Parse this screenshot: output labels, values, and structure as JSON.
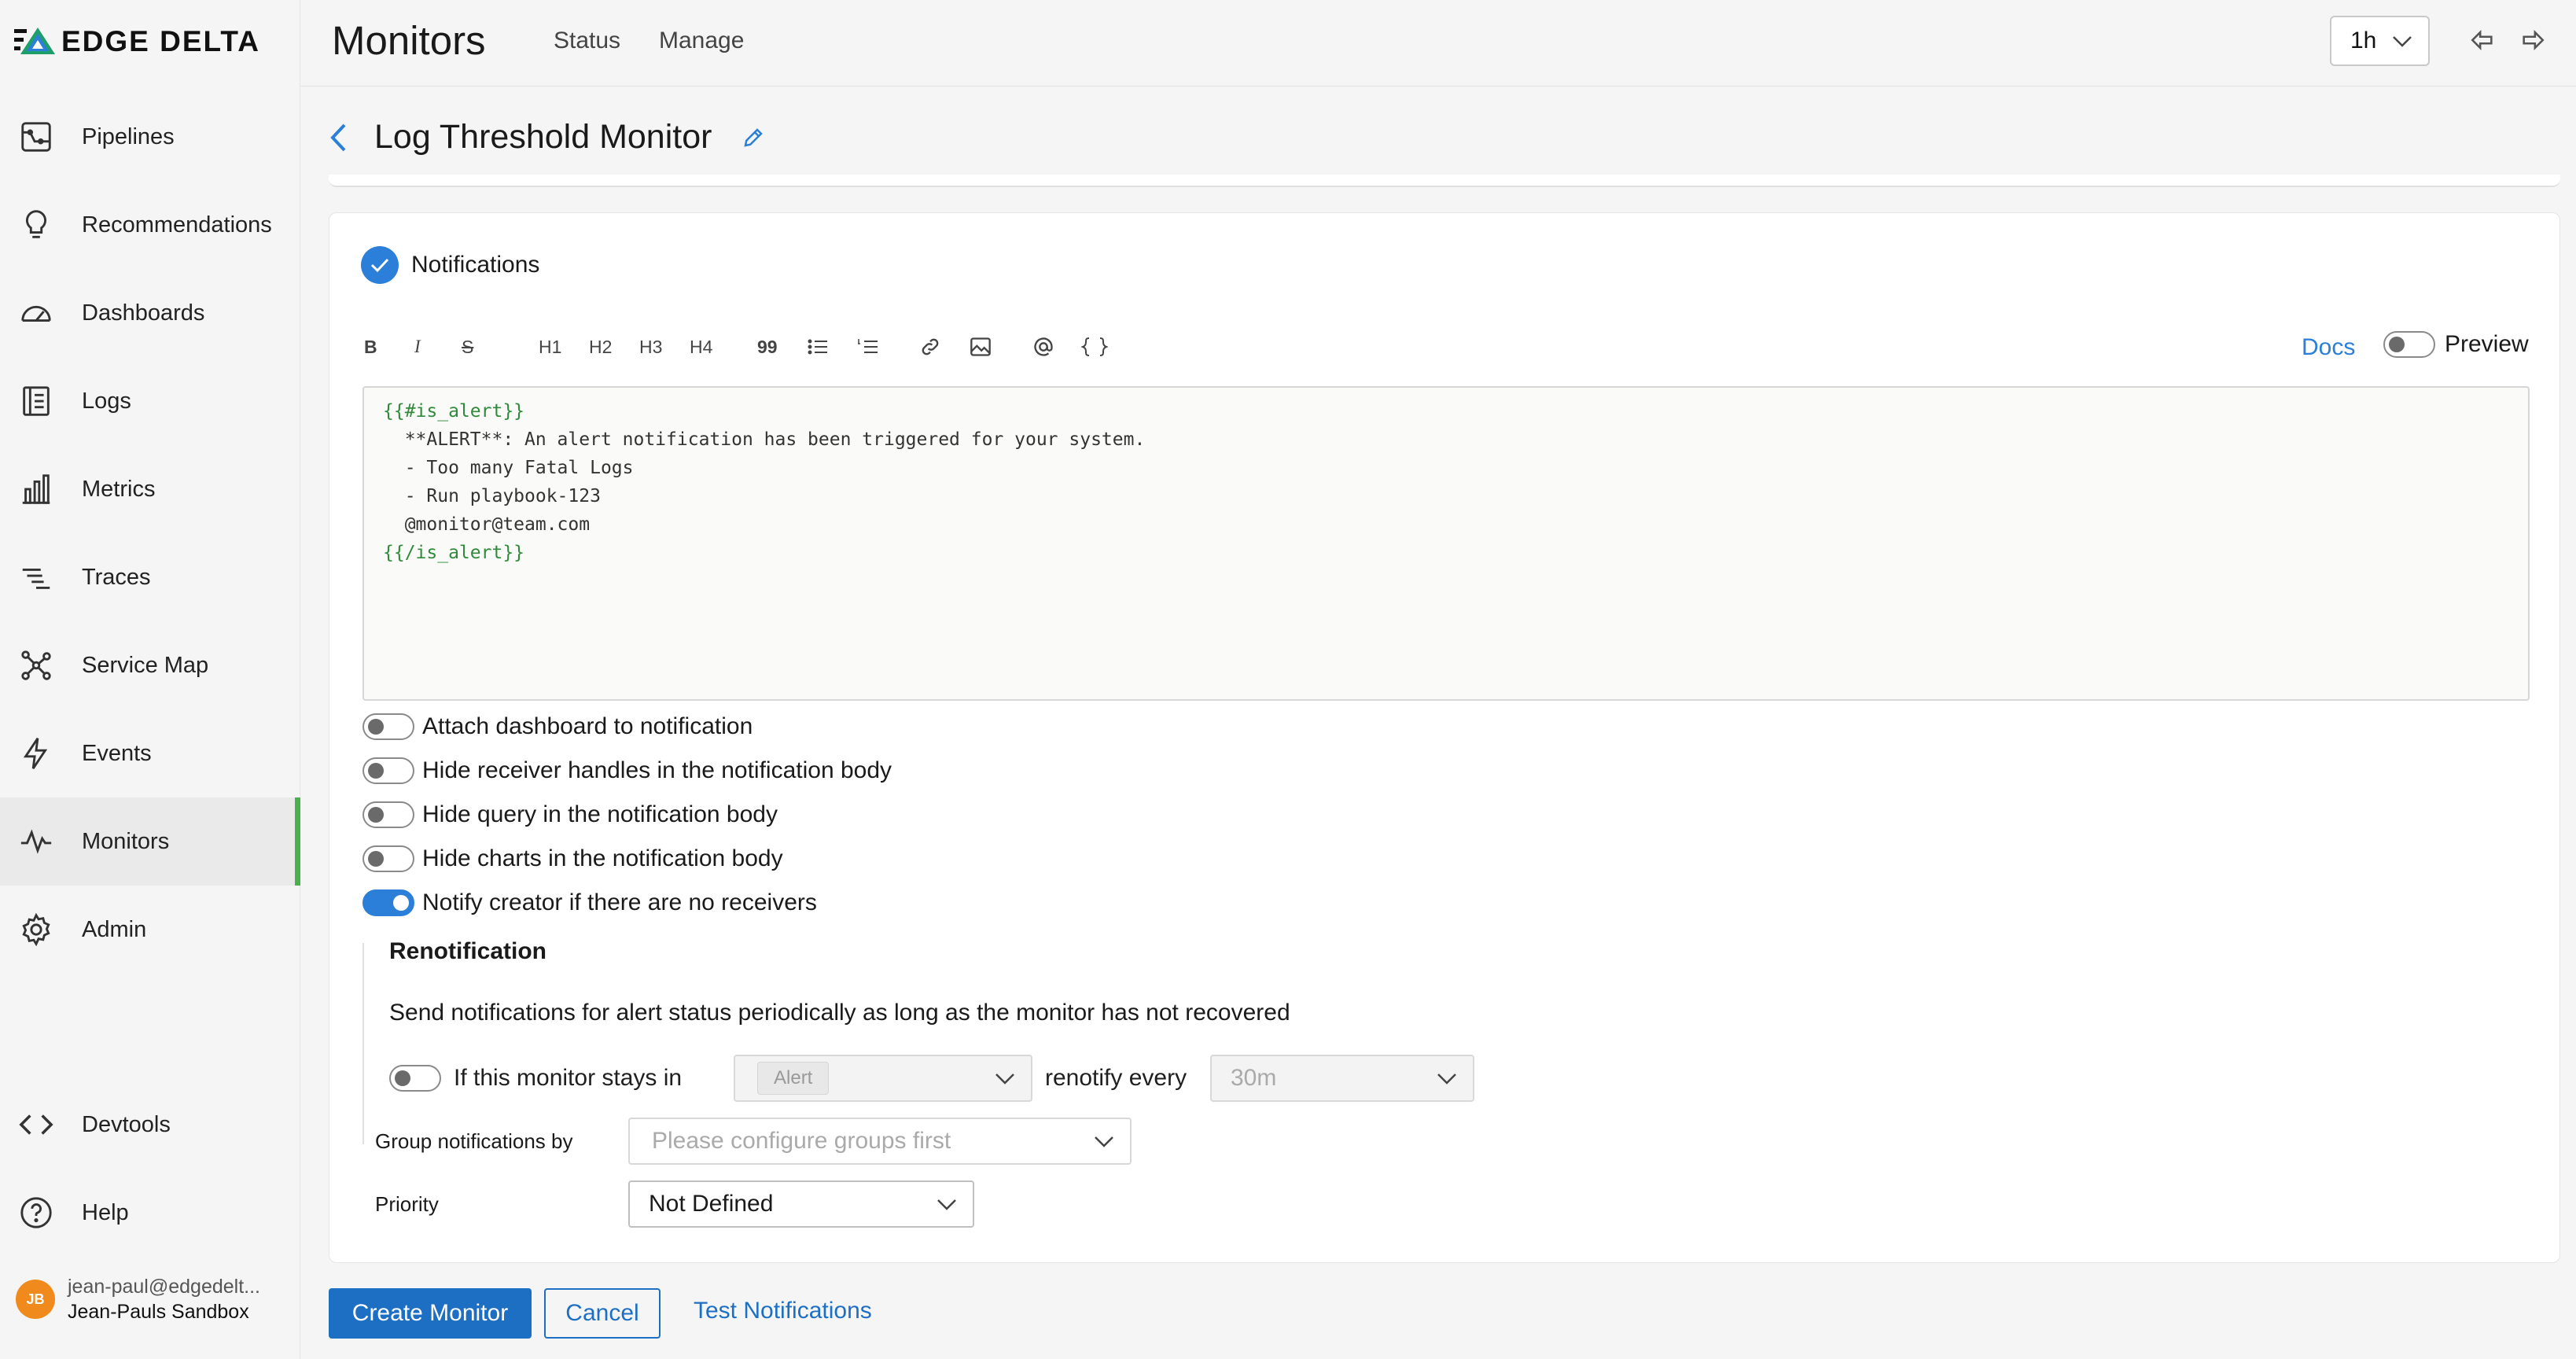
{
  "app": {
    "logo_text": "EDGE DELTA"
  },
  "sidebar": {
    "items": [
      {
        "label": "Pipelines",
        "icon": "pipeline-icon"
      },
      {
        "label": "Recommendations",
        "icon": "lightbulb-icon"
      },
      {
        "label": "Dashboards",
        "icon": "gauge-icon"
      },
      {
        "label": "Logs",
        "icon": "logs-icon"
      },
      {
        "label": "Metrics",
        "icon": "bar-chart-icon"
      },
      {
        "label": "Traces",
        "icon": "traces-icon"
      },
      {
        "label": "Service Map",
        "icon": "service-map-icon"
      },
      {
        "label": "Events",
        "icon": "lightning-icon"
      },
      {
        "label": "Monitors",
        "icon": "pulse-icon",
        "active": true
      },
      {
        "label": "Admin",
        "icon": "gear-icon"
      },
      {
        "label": "Devtools",
        "icon": "code-icon"
      },
      {
        "label": "Help",
        "icon": "help-icon"
      }
    ],
    "user": {
      "initials": "JB",
      "email": "jean-paul@edgedelt...",
      "org": "Jean-Pauls Sandbox"
    }
  },
  "header": {
    "title": "Monitors",
    "tabs": [
      "Status",
      "Manage"
    ],
    "time_range": "1h"
  },
  "monitor": {
    "title": "Log Threshold Monitor"
  },
  "notifications": {
    "title": "Notifications",
    "toolbar": [
      "B",
      "I",
      "S",
      "H1",
      "H2",
      "H3",
      "H4",
      "99"
    ],
    "docs_label": "Docs",
    "preview_label": "Preview",
    "editor_lines": [
      "{{#is_alert}}",
      "  **ALERT**: An alert notification has been triggered for your system.",
      "  - Too many Fatal Logs",
      "  - Run playbook-123",
      "  @monitor@team.com",
      "{{/is_alert}}"
    ],
    "options": [
      {
        "label": "Attach dashboard to notification",
        "on": false
      },
      {
        "label": "Hide receiver handles in the notification body",
        "on": false
      },
      {
        "label": "Hide query in the notification body",
        "on": false
      },
      {
        "label": "Hide charts in the notification body",
        "on": false
      },
      {
        "label": "Notify creator if there are no receivers",
        "on": true
      }
    ]
  },
  "renotification": {
    "title": "Renotification",
    "description": "Send notifications for alert status periodically as long as the monitor has not recovered",
    "stays_in_label": "If this monitor stays in",
    "state_value": "Alert",
    "renotify_label": "renotify every",
    "interval_value": "30m"
  },
  "group": {
    "label": "Group notifications by",
    "placeholder": "Please configure groups first"
  },
  "priority": {
    "label": "Priority",
    "value": "Not Defined"
  },
  "actions": {
    "create": "Create Monitor",
    "cancel": "Cancel",
    "test": "Test Notifications"
  },
  "colors": {
    "accent": "#2b7fd8",
    "active_indicator": "#4caf50",
    "avatar": "#f08a1c"
  }
}
